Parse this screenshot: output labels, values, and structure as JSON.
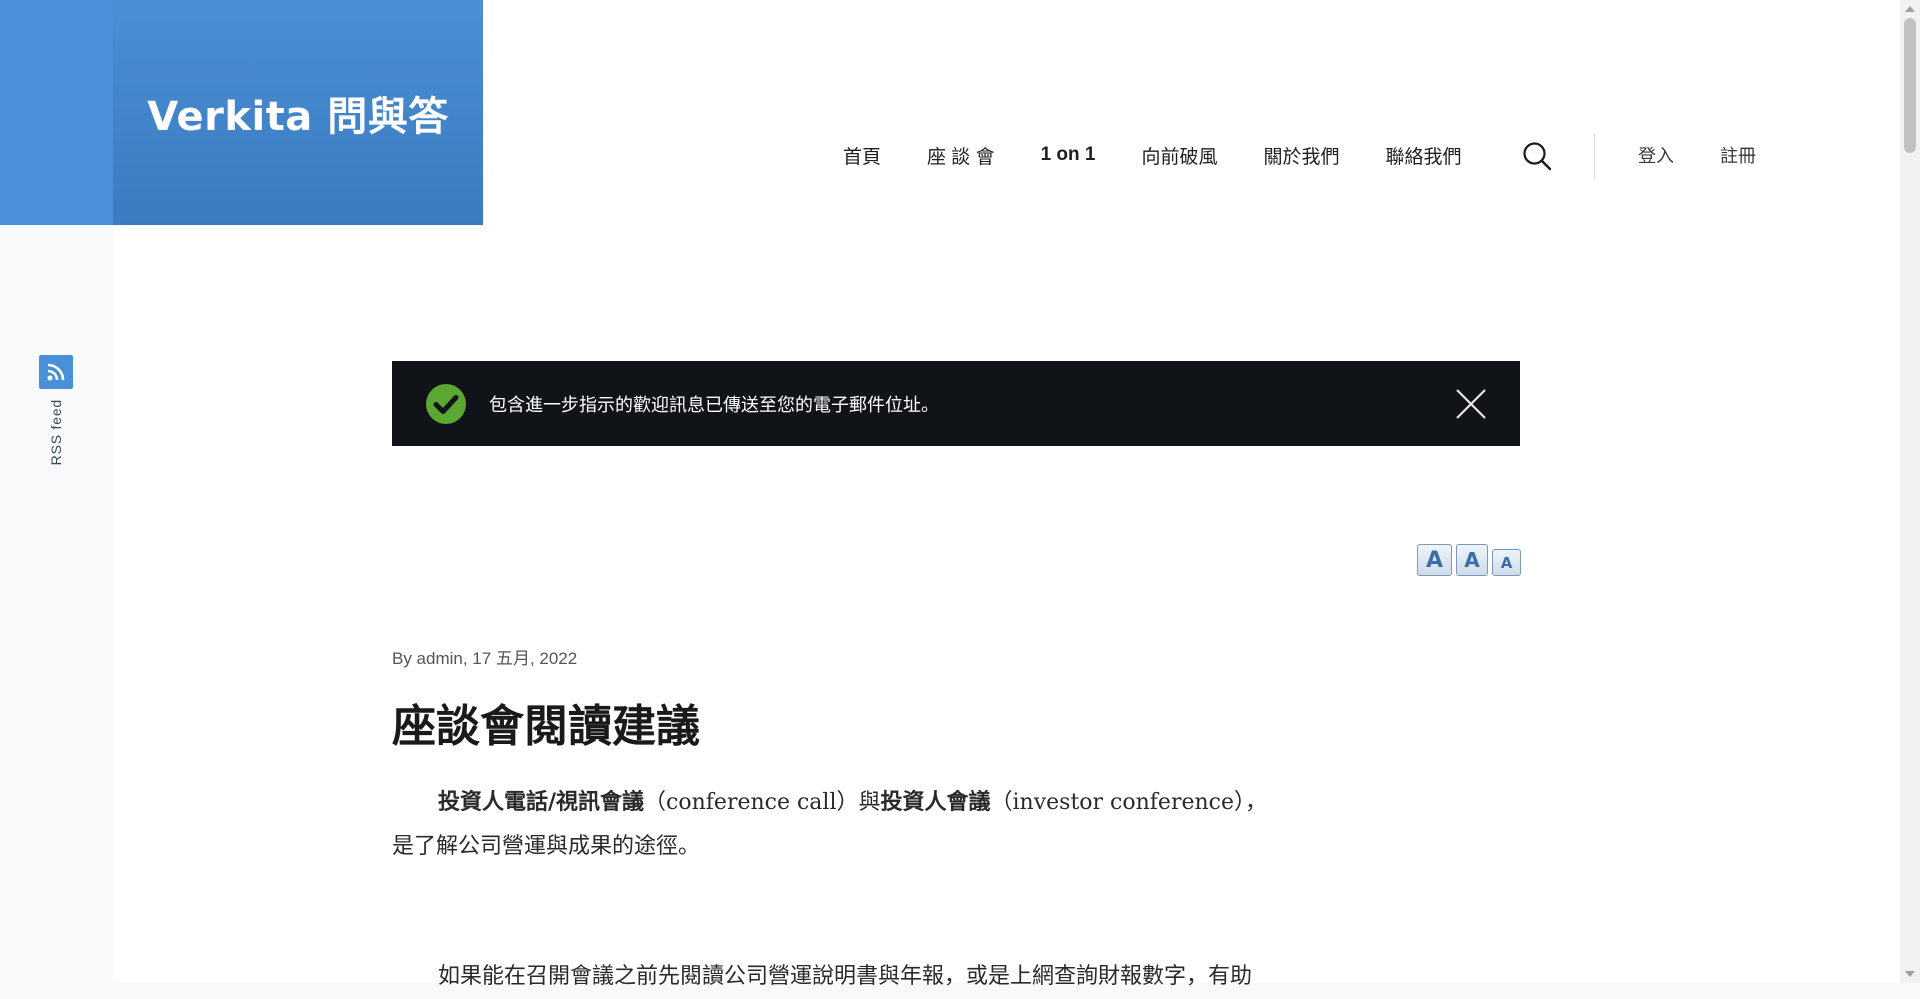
{
  "site": {
    "title": "Verkita 問與答"
  },
  "sidebar": {
    "rss_label": "RSS feed"
  },
  "nav": {
    "items": [
      {
        "label": "首頁"
      },
      {
        "label": "座 談 會"
      },
      {
        "label": "1 on 1"
      },
      {
        "label": "向前破風"
      },
      {
        "label": "關於我們"
      },
      {
        "label": "聯絡我們"
      }
    ],
    "login": "登入",
    "register": "註冊"
  },
  "alert": {
    "message": "包含進一步指示的歡迎訊息已傳送至您的電子郵件位址。",
    "accent_color": "#5aa832"
  },
  "font_tools": {
    "large": "A",
    "normal": "A",
    "small": "A"
  },
  "article": {
    "byline": "By admin, 17 五月, 2022",
    "title": "座談會閱讀建議",
    "p1_bold1": "投資人電話/視訊會議",
    "p1_text1": "（conference call）與",
    "p1_bold2": "投資人會議",
    "p1_text2": "（investor conference），",
    "p1_line2": "是了解公司營運與成果的途徑。",
    "p2": "如果能在召開會議之前先閱讀公司營運說明書與年報，或是上網查詢財報數字，有助"
  },
  "colors": {
    "brand": "#4a90d9",
    "brand_dark": "#3b7bbf",
    "alert_bg": "#101418"
  }
}
